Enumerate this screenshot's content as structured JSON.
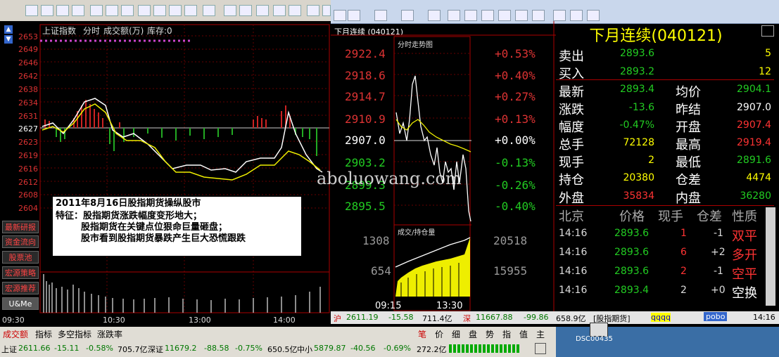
{
  "left_chart": {
    "index_name": "上证指数",
    "mode": "分时",
    "volume_label": "成交额(万)",
    "stock_label": "库存:0",
    "y_labels": [
      "2653",
      "2649",
      "2646",
      "2642",
      "2638",
      "2634",
      "2631",
      "2627",
      "2623",
      "2619",
      "2616",
      "2612",
      "2608",
      "2604"
    ],
    "x_labels": [
      "09:30",
      "10:30",
      "13:00",
      "14:00"
    ]
  },
  "annotation": {
    "line1": "2011年8月16日股指期货操纵股市",
    "line2": "特征：股指期货涨跌幅度变形地大；",
    "line3": "股指期货在关键点位狠命巨量砸盘；",
    "line4": "股市看到股指期货暴跌产生巨大恐慌跟跌"
  },
  "side_buttons": [
    "最新研报",
    "资金流向",
    "股票池",
    "宏源策略",
    "宏源推荐",
    "U&Me"
  ],
  "right_window": {
    "title": "下月连续",
    "code": "(040121)",
    "chart_title": "分时走势图",
    "prices": [
      "2922.4",
      "2918.6",
      "2914.7",
      "2910.9",
      "2907.0",
      "2903.2",
      "2899.3",
      "2895.5"
    ],
    "percents": [
      "+0.53%",
      "+0.40%",
      "+0.27%",
      "+0.13%",
      "+0.00%",
      "-0.13%",
      "-0.26%",
      "-0.40%"
    ],
    "vol_title": "成交/持仓量",
    "vol_left": [
      "1308",
      "654"
    ],
    "vol_right": [
      "20518",
      "15955"
    ],
    "x_labels": [
      "09:15",
      "13:30"
    ],
    "header_name": "下月连续(040121)",
    "quote_rows": [
      {
        "label": "卖出",
        "value": "2893.6",
        "extra": "5"
      },
      {
        "label": "买入",
        "value": "2893.2",
        "extra": "12"
      }
    ],
    "stats": [
      {
        "l1": "最新",
        "v1": "2893.4",
        "l2": "均价",
        "v2": "2904.1"
      },
      {
        "l1": "涨跌",
        "v1": "-13.6",
        "l2": "昨结",
        "v2": "2907.0"
      },
      {
        "l1": "幅度",
        "v1": "-0.47%",
        "l2": "开盘",
        "v2": "2907.4"
      },
      {
        "l1": "总手",
        "v1": "72128",
        "l2": "最高",
        "v2": "2919.4"
      },
      {
        "l1": "现手",
        "v1": "2",
        "l2": "最低",
        "v2": "2891.6"
      },
      {
        "l1": "持仓",
        "v1": "20380",
        "l2": "仓差",
        "v2": "4474"
      },
      {
        "l1": "外盘",
        "v1": "35834",
        "l2": "内盘",
        "v2": "36280"
      }
    ],
    "trade_headers": [
      "北京",
      "价格",
      "现手",
      "仓差",
      "性质"
    ],
    "trades": [
      {
        "time": "14:16",
        "price": "2893.6",
        "qty": "1",
        "diff": "-1",
        "type": "双平"
      },
      {
        "time": "14:16",
        "price": "2893.6",
        "qty": "6",
        "diff": "+2",
        "type": "多开"
      },
      {
        "time": "14:16",
        "price": "2893.6",
        "qty": "2",
        "diff": "-1",
        "type": "空平"
      },
      {
        "time": "14:16",
        "price": "2893.4",
        "qty": "2",
        "diff": "+0",
        "type": "空换"
      }
    ]
  },
  "ticker": {
    "sh_label": "沪",
    "sh_val": "2611.19",
    "sh_chg": "-15.58",
    "sh_amt": "711.4亿",
    "sz_label": "深",
    "sz_val": "11667.88",
    "sz_chg": "-99.86",
    "sz_amt": "658.9亿",
    "tag": "[股指期货]",
    "qq": "qqqq",
    "pobo": "pobo",
    "time": "14:16"
  },
  "bottom_tabs": [
    "成交额",
    "指标",
    "多空指标",
    "涨跌率"
  ],
  "bottom_right_tabs": [
    "笔",
    "价",
    "细",
    "盘",
    "势",
    "指",
    "值",
    "主"
  ],
  "status_bar": {
    "sh": "上证",
    "sh_val": "2611.66",
    "sh_chg": "-15.11",
    "sh_pct": "-0.58%",
    "sh_amt": "705.7亿",
    "sz": "深证",
    "sz_val": "11679.2",
    "sz_chg": "-88.58",
    "sz_pct": "-0.75%",
    "sz_amt": "650.5亿",
    "zx": "中小",
    "zx_val": "5879.87",
    "zx_chg": "-40.56",
    "zx_pct": "-0.69%",
    "zx_amt": "272.2亿"
  },
  "desktop_icon": "DSC00435",
  "watermark": "aboluowang.com"
}
